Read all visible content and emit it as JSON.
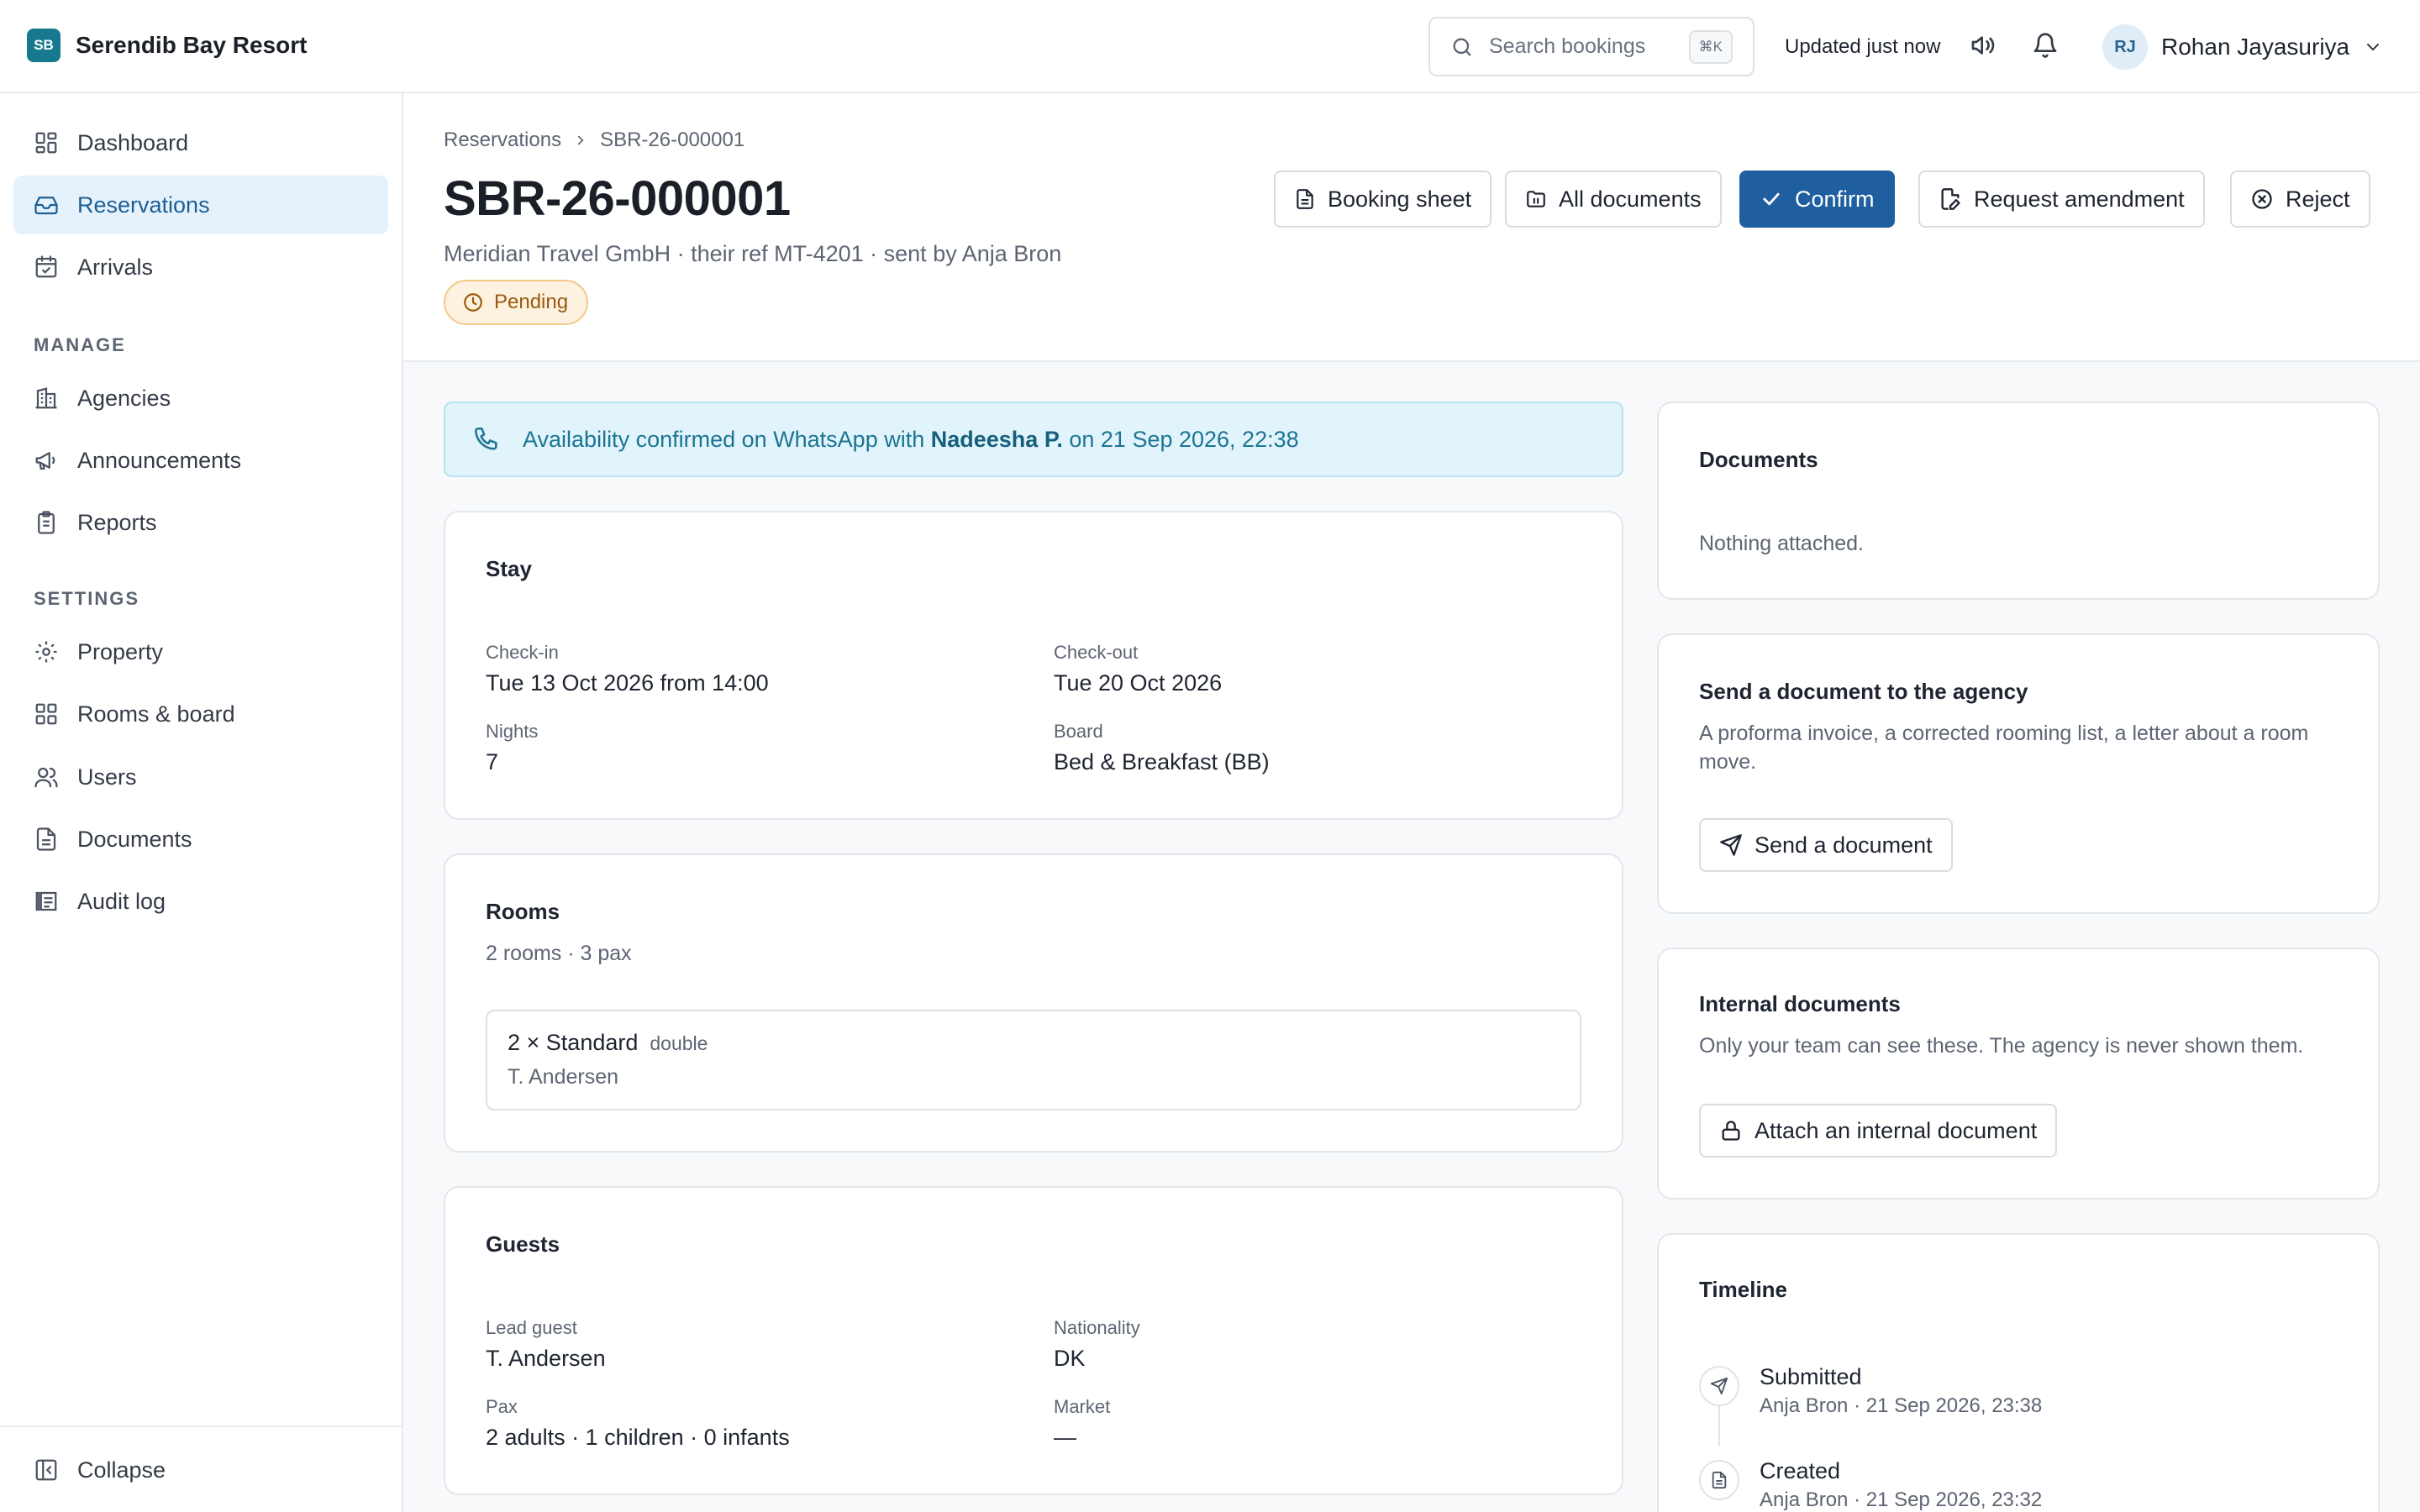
{
  "app": {
    "logo_text": "SB",
    "name": "Serendib Bay Resort",
    "search_placeholder": "Search bookings",
    "search_shortcut": "⌘K",
    "updated": "Updated just now",
    "user_initials": "RJ",
    "user_name": "Rohan Jayasuriya"
  },
  "sidebar": {
    "main": [
      {
        "label": "Dashboard",
        "icon": "dashboard-icon"
      },
      {
        "label": "Reservations",
        "icon": "inbox-icon",
        "active": true
      },
      {
        "label": "Arrivals",
        "icon": "calendar-check-icon"
      }
    ],
    "manage_heading": "MANAGE",
    "manage": [
      {
        "label": "Agencies",
        "icon": "building-icon"
      },
      {
        "label": "Announcements",
        "icon": "megaphone-icon"
      },
      {
        "label": "Reports",
        "icon": "clipboard-icon"
      }
    ],
    "settings_heading": "SETTINGS",
    "settings": [
      {
        "label": "Property",
        "icon": "gear-icon"
      },
      {
        "label": "Rooms & board",
        "icon": "grid-icon"
      },
      {
        "label": "Users",
        "icon": "users-icon"
      },
      {
        "label": "Documents",
        "icon": "file-text-icon"
      },
      {
        "label": "Audit log",
        "icon": "audit-log-icon"
      }
    ],
    "collapse": "Collapse"
  },
  "header": {
    "breadcrumb": [
      "Reservations",
      "SBR-26-000001"
    ],
    "title": "SBR-26-000001",
    "subtitle": "Meridian Travel GmbH · their ref MT-4201 · sent by Anja Bron",
    "status": "Pending",
    "actions": {
      "booking_sheet": "Booking sheet",
      "all_documents": "All documents",
      "confirm": "Confirm",
      "request_amendment": "Request amendment",
      "reject": "Reject"
    }
  },
  "alert": {
    "prefix": "Availability confirmed on WhatsApp with",
    "name": "Nadeesha P.",
    "suffix": "on 21 Sep 2026, 22:38"
  },
  "stay": {
    "title": "Stay",
    "checkin_label": "Check-in",
    "checkin": "Tue 13 Oct 2026 from 14:00",
    "checkout_label": "Check-out",
    "checkout": "Tue 20 Oct 2026",
    "nights_label": "Nights",
    "nights": "7",
    "board_label": "Board",
    "board": "Bed & Breakfast (BB)"
  },
  "rooms": {
    "title": "Rooms",
    "summary": "2 rooms · 3 pax",
    "items": [
      {
        "name": "2 × Standard",
        "type": "double",
        "guest": "T. Andersen"
      }
    ]
  },
  "guests": {
    "title": "Guests",
    "lead_label": "Lead guest",
    "lead": "T. Andersen",
    "nationality_label": "Nationality",
    "nationality": "DK",
    "pax_label": "Pax",
    "pax": "2 adults · 1 children · 0 infants",
    "market_label": "Market",
    "market": "—"
  },
  "documents": {
    "title": "Documents",
    "empty": "Nothing attached."
  },
  "send_doc": {
    "title": "Send a document to the agency",
    "description": "A proforma invoice, a corrected rooming list, a letter about a room move.",
    "button": "Send a document"
  },
  "internal_docs": {
    "title": "Internal documents",
    "description": "Only your team can see these. The agency is never shown them.",
    "button": "Attach an internal document"
  },
  "timeline": {
    "title": "Timeline",
    "events": [
      {
        "title": "Submitted",
        "meta": "Anja Bron · 21 Sep 2026, 23:38",
        "icon": "send-icon"
      },
      {
        "title": "Created",
        "meta": "Anja Bron · 21 Sep 2026, 23:32",
        "icon": "file-icon"
      }
    ]
  },
  "colors": {
    "brand": "#17798f",
    "primary": "#1f5f9f",
    "active_nav_bg": "#e5f2fc",
    "pending_bg": "#fdf1df",
    "pending_text": "#9a5a10",
    "alert_bg": "#e2f4fb"
  }
}
